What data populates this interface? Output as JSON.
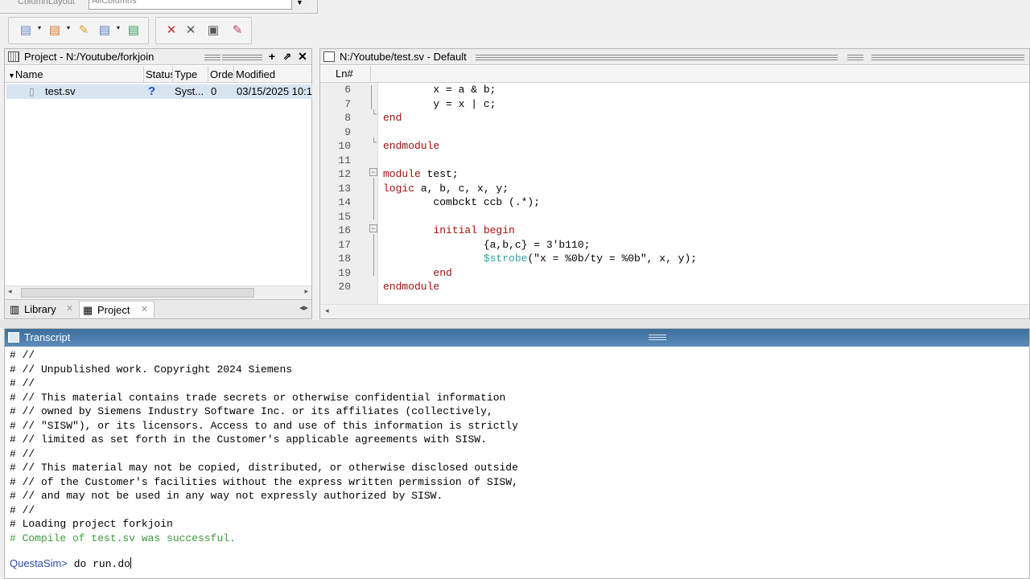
{
  "top": {
    "combo_value": "AllColumns",
    "left_text": "ColumnLayout"
  },
  "toolbar": {
    "buttons": [
      "compile-icon",
      "compile-all-icon",
      "compile-options-icon",
      "add-to-project-icon",
      "project-settings-icon",
      "remove-icon",
      "close-icon",
      "simulate-icon",
      "break-icon"
    ]
  },
  "project_pane": {
    "title": "Project - N:/Youtube/forkjoin",
    "columns": [
      "Name",
      "Status",
      "Type",
      "Order",
      "Modified"
    ],
    "rows": [
      {
        "name": "test.sv",
        "status": "?",
        "type": "Syst...",
        "order": "0",
        "modified": "03/15/2025 10:1"
      }
    ],
    "tabs": [
      "Library",
      "Project"
    ]
  },
  "source_pane": {
    "title": "N:/Youtube/test.sv - Default",
    "ln_header": "Ln#",
    "line_numbers": [
      "6",
      "7",
      "8",
      "9",
      "10",
      "11",
      "12",
      "13",
      "14",
      "15",
      "16",
      "17",
      "18",
      "19",
      "20"
    ]
  },
  "transcript": {
    "title": "Transcript",
    "lines": [
      "# //",
      "# // Unpublished work. Copyright 2024 Siemens",
      "# //",
      "# // This material contains trade secrets or otherwise confidential information",
      "# // owned by Siemens Industry Software Inc. or its affiliates (collectively,",
      "# // \"SISW\"), or its licensors. Access to and use of this information is strictly",
      "# // limited as set forth in the Customer's applicable agreements with SISW.",
      "# //",
      "# // This material may not be copied, distributed, or otherwise disclosed outside",
      "# // of the Customer's facilities without the express written permission of SISW,",
      "# // and may not be used in any way not expressly authorized by SISW.",
      "# //",
      "# Loading project forkjoin"
    ],
    "success_line": "# Compile of test.sv was successful.",
    "prompt": "QuestaSim>",
    "command": " do run.do"
  },
  "colors": {
    "keyword": "#a01010",
    "system_task": "#2aa8a0",
    "success": "#3c9c3c",
    "prompt": "#2b4aa5",
    "title_bar": "#4a7cab"
  }
}
